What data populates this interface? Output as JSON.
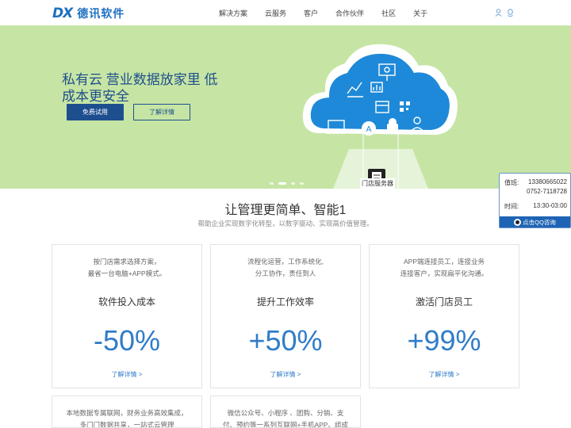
{
  "header": {
    "logo_mark": "DX",
    "logo_text": "德讯软件",
    "nav": [
      "解决方案",
      "云服务",
      "客户",
      "合作伙伴",
      "社区",
      "关于"
    ]
  },
  "banner": {
    "title": "私有云 营业数据放家里 低成本更安全",
    "btn_trial": "免费试用",
    "btn_detail": "了解详情",
    "server_label": "门店服务器"
  },
  "contact": {
    "label_phone": "值班:",
    "phone1": "13380665022",
    "phone2": "0752-7118728",
    "label_time": "时间:",
    "time": "13:30-03:00",
    "qq": "点击QQ咨询"
  },
  "section": {
    "title": "让管理更简单、智能1",
    "subtitle": "帮助企业实现数字化转型，以数字驱动、实现高价值管理。"
  },
  "cards": [
    {
      "desc1": "按门店需求选择方案，",
      "desc2": "最省一台电脑+APP模式。",
      "head": "软件投入成本",
      "num": "-50%",
      "link": "了解详情 >"
    },
    {
      "desc1": "流程化运营，工作系统化,",
      "desc2": "分工协作，责任到人",
      "head": "提升工作效率",
      "num": "+50%",
      "link": "了解详情 >"
    },
    {
      "desc1": "APP端连接员工，连接业务",
      "desc2": "连接客户，实现扁平化沟通。",
      "head": "激活门店员工",
      "num": "+99%",
      "link": "了解详情 >"
    }
  ],
  "cards2": [
    {
      "desc1": "本地数据专属联网，财务业务高效集成，",
      "desc2": "多门门数据共享，一站式云管理"
    },
    {
      "desc1": "微信公众号、小程序 、团购、分销、支",
      "desc2": "付、预约等一系列互联网+手机APP、组成"
    }
  ]
}
